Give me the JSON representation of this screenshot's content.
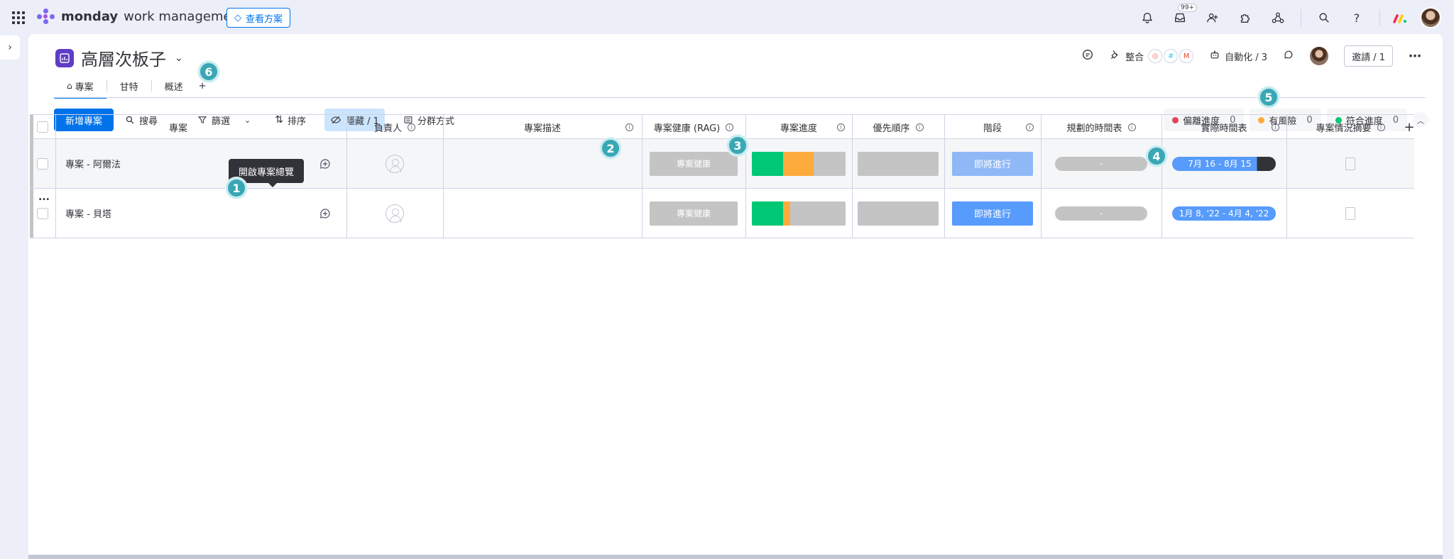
{
  "brand": {
    "name": "monday",
    "product": "work management",
    "plan_button": "查看方案"
  },
  "top_icons": {
    "inbox_badge": "99+"
  },
  "board": {
    "title": "高層次板子",
    "tabs": [
      {
        "label": "專案"
      },
      {
        "label": "甘特"
      },
      {
        "label": "概述"
      },
      {
        "label": "+"
      }
    ],
    "header_right": {
      "integrate": "整合",
      "automations": "自動化 / 3",
      "invite": "邀請 / 1"
    }
  },
  "toolbar": {
    "new_project": "新增專案",
    "search": "搜尋",
    "filter": "篩選",
    "sort": "排序",
    "hide": "隱藏 / 1",
    "group_by": "分群方式"
  },
  "status_filters": [
    {
      "label": "偏離進度",
      "count": "0",
      "color": "#e2445c"
    },
    {
      "label": "有風險",
      "count": "0",
      "color": "#fdab3d"
    },
    {
      "label": "符合進度",
      "count": "0",
      "color": "#00c875"
    }
  ],
  "columns": {
    "project": "專案",
    "owner": "負責人",
    "description": "專案描述",
    "health": "專案健康 (RAG)",
    "progress": "專案進度",
    "priority": "優先順序",
    "stage": "階段",
    "planned_timeline": "規劃的時間表",
    "actual_timeline": "實際時間表",
    "summary": "專案情況摘要"
  },
  "rows": [
    {
      "name": "專案 - 阿爾法",
      "overview_label": "總覽",
      "health": "專案健康",
      "progress": [
        {
          "fraction": 0.33,
          "color": "#00c875"
        },
        {
          "fraction": 0.33,
          "color": "#fdab3d"
        },
        {
          "fraction": 0.34,
          "color": "#c4c4c4"
        }
      ],
      "stage": "即將進行",
      "stage_color": "#8fb8f7",
      "planned": "-",
      "actual": "7月 16 - 8月 15"
    },
    {
      "name": "專案 - 貝塔",
      "health": "專案健康",
      "progress": [
        {
          "fraction": 0.33,
          "color": "#00c875"
        },
        {
          "fraction": 0.08,
          "color": "#fdab3d"
        },
        {
          "fraction": 0.59,
          "color": "#c4c4c4"
        }
      ],
      "stage": "即將進行",
      "stage_color": "#579bfc",
      "planned": "-",
      "actual": "1月 8, '22 - 4月 4, '22"
    }
  ],
  "tooltip": "開啟專案總覽",
  "callouts": [
    "1",
    "2",
    "3",
    "4",
    "5",
    "6"
  ],
  "row_menu": "..."
}
